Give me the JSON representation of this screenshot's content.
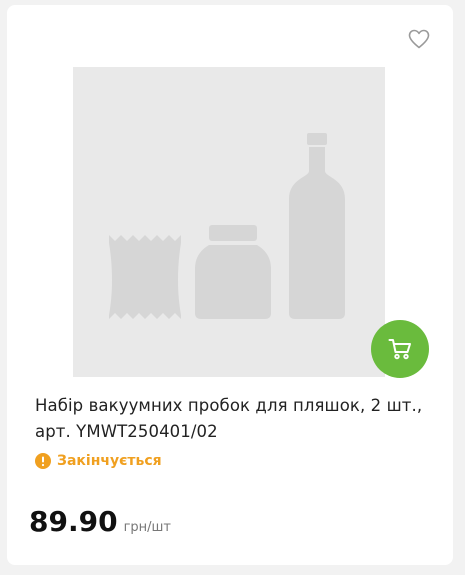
{
  "product": {
    "title_line1": "Набір вакуумних пробок для пляшок, 2 шт.,",
    "title_line2": "арт. YMWT250401/02",
    "status": "Закінчується",
    "price": "89.90",
    "unit": "грн/шт"
  },
  "icons": {
    "favorite": "heart-icon",
    "cart": "cart-icon",
    "status": "exclamation-circle-icon",
    "placeholder": "product-placeholder-image"
  },
  "colors": {
    "accent_green": "#6abb3d",
    "status_orange": "#f0a020",
    "placeholder_bg": "#e9e9e9",
    "placeholder_shape": "#d6d6d6"
  }
}
